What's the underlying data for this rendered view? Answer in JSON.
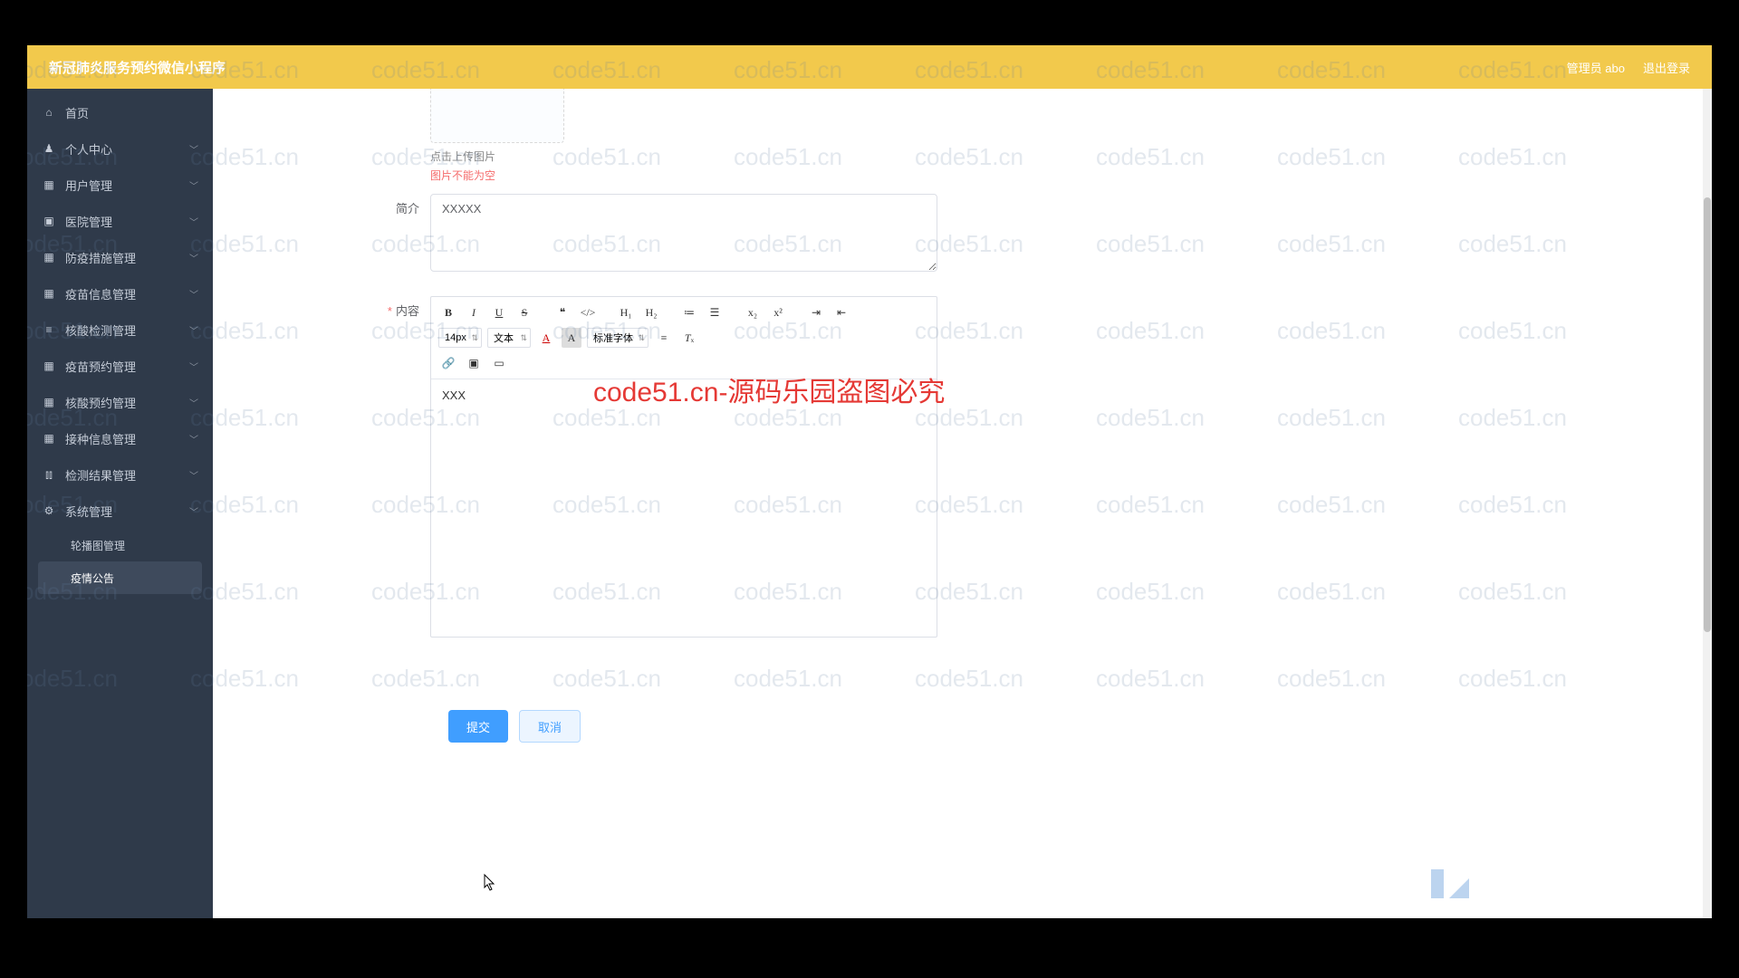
{
  "header": {
    "title": "新冠肺炎服务预约微信小程序",
    "admin_label": "管理员 abo",
    "logout_label": "退出登录"
  },
  "sidebar": {
    "items": [
      {
        "label": "首页",
        "icon": "home",
        "expandable": false
      },
      {
        "label": "个人中心",
        "icon": "user",
        "expandable": true
      },
      {
        "label": "用户管理",
        "icon": "grid",
        "expandable": true
      },
      {
        "label": "医院管理",
        "icon": "briefcase",
        "expandable": true
      },
      {
        "label": "防疫措施管理",
        "icon": "grid",
        "expandable": true
      },
      {
        "label": "疫苗信息管理",
        "icon": "grid",
        "expandable": true
      },
      {
        "label": "核酸检测管理",
        "icon": "list",
        "expandable": true
      },
      {
        "label": "疫苗预约管理",
        "icon": "grid",
        "expandable": true
      },
      {
        "label": "核酸预约管理",
        "icon": "grid",
        "expandable": true
      },
      {
        "label": "接种信息管理",
        "icon": "grid",
        "expandable": true
      },
      {
        "label": "检测结果管理",
        "icon": "chart",
        "expandable": true
      },
      {
        "label": "系统管理",
        "icon": "gear",
        "expandable": true
      }
    ],
    "sub_items": [
      {
        "label": "轮播图管理",
        "active": false
      },
      {
        "label": "疫情公告",
        "active": true
      }
    ]
  },
  "form": {
    "upload_hint": "点击上传图片",
    "upload_error": "图片不能为空",
    "intro_label": "简介",
    "intro_value": "XXXXX",
    "content_label": "内容",
    "content_value": "XXX"
  },
  "editor_toolbar": {
    "font_size": "14px",
    "block_format": "文本",
    "font_family": "标准字体"
  },
  "actions": {
    "submit": "提交",
    "cancel": "取消"
  },
  "watermark": {
    "text": "code51.cn",
    "red_text": "code51.cn-源码乐园盗图必究"
  }
}
